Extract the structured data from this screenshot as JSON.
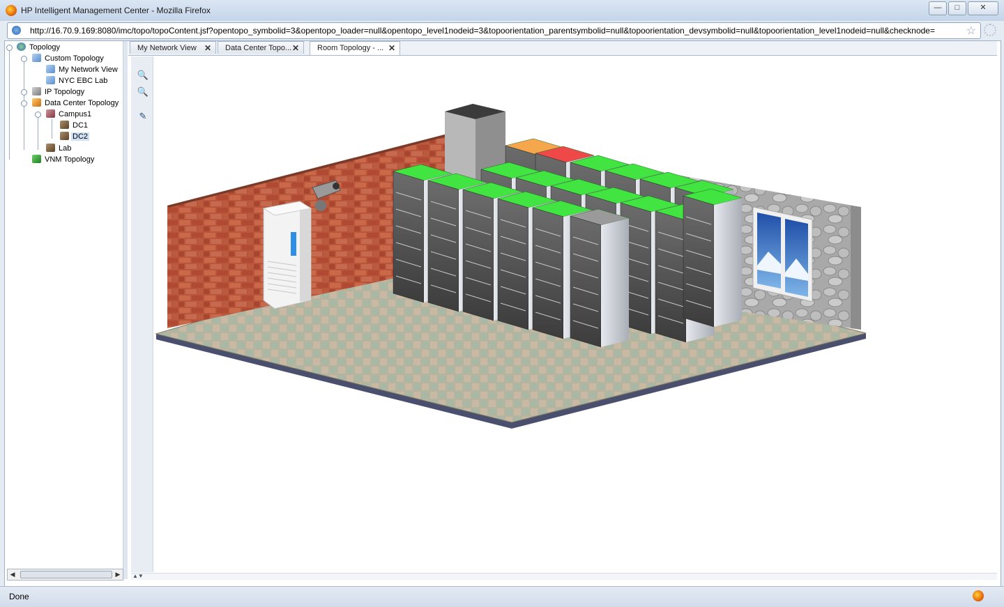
{
  "window": {
    "title": "HP Intelligent Management Center - Mozilla Firefox",
    "minimize": "—",
    "maximize": "□",
    "close": "✕"
  },
  "urlbar": {
    "url": "http://16.70.9.169:8080/imc/topo/topoContent.jsf?opentopo_symbolid=3&opentopo_loader=null&opentopo_level1nodeid=3&topoorientation_parentsymbolid=null&topoorientation_devsymbolid=null&topoorientation_level1nodeid=null&checknode="
  },
  "tree": {
    "root": "Topology",
    "custom": "Custom Topology",
    "my_network_view": "My Network View",
    "nyc_ebc_lab": "NYC EBC Lab",
    "ip": "IP Topology",
    "data_center": "Data Center Topology",
    "campus1": "Campus1",
    "dc1": "DC1",
    "dc2": "DC2",
    "lab": "Lab",
    "vnm": "VNM Topology"
  },
  "tabs": [
    {
      "label": "My Network View"
    },
    {
      "label": "Data Center Topo..."
    },
    {
      "label": "Room Topology - ..."
    }
  ],
  "tools": {
    "zoom_in": "🔍",
    "zoom_out": "🔍",
    "edit": "✎"
  },
  "scene": {
    "rack_status_colors": [
      "#f6a64c",
      "#ef4848",
      "#42e442",
      "#9a9a9a"
    ],
    "window_view": "mountain landscape"
  },
  "status": {
    "text": "Done"
  }
}
